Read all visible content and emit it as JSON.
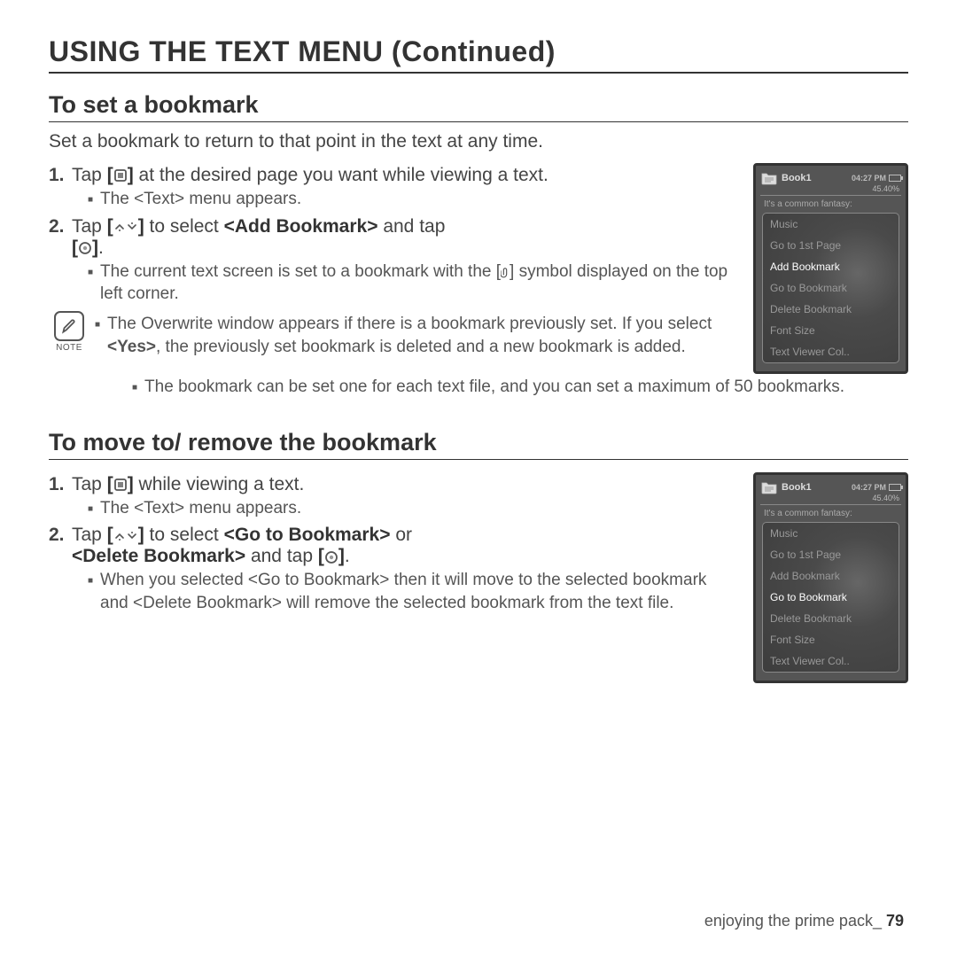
{
  "title": "USING THE TEXT MENU (Continued)",
  "section1": {
    "heading": "To set a bookmark",
    "intro": "Set a bookmark to return to that point in the text at any time.",
    "step1_num": "1.",
    "step1_a": "Tap ",
    "step1_b": " at the desired page you want while viewing a text.",
    "sub1": "The <Text> menu appears.",
    "step2_num": "2.",
    "step2_a": "Tap ",
    "step2_b": " to select ",
    "step2_bold": "<Add Bookmark>",
    "step2_c": " and tap ",
    "step2_d": ".",
    "sub2_a": "The current text screen is set to a bookmark with the ",
    "sub2_b": " symbol displayed on the top left corner.",
    "note_label": "NOTE",
    "note1_a": "The Overwrite window appears if there is a bookmark previously set. If you select ",
    "note1_bold": "<Yes>",
    "note1_b": ", the previously set bookmark is deleted and a new bookmark is added.",
    "note2": "The bookmark can be set one for each text file, and you can set a maximum of 50 bookmarks."
  },
  "section2": {
    "heading": "To move to/ remove the bookmark",
    "step1_num": "1.",
    "step1_a": "Tap ",
    "step1_b": " while viewing a text.",
    "sub1": "The <Text> menu appears.",
    "step2_num": "2.",
    "step2_a": "Tap ",
    "step2_b": " to select ",
    "step2_bold1": "<Go to Bookmark>",
    "step2_c": " or ",
    "step2_bold2": "<Delete Bookmark>",
    "step2_d": " and tap ",
    "step2_e": ".",
    "sub2": "When you selected <Go to Bookmark> then it will move to the selected bookmark and <Delete Bookmark> will remove the selected bookmark from the text file."
  },
  "device1": {
    "book": "Book1",
    "time": "04:27 PM",
    "pct": "45.40%",
    "subtitle": "It's a common fantasy:",
    "items": [
      "Music",
      "Go to 1st Page",
      "Add Bookmark",
      "Go to Bookmark",
      "Delete Bookmark",
      "Font Size",
      "Text Viewer Col.."
    ],
    "selected": 2
  },
  "device2": {
    "book": "Book1",
    "time": "04:27 PM",
    "pct": "45.40%",
    "subtitle": "It's a common fantasy:",
    "items": [
      "Music",
      "Go to 1st Page",
      "Add Bookmark",
      "Go to Bookmark",
      "Delete Bookmark",
      "Font Size",
      "Text Viewer Col.."
    ],
    "selected": 3
  },
  "footer": {
    "text": "enjoying the prime pack_ ",
    "page": "79"
  },
  "icons": {
    "menu_open": "[",
    "menu_close": "]",
    "brackets_open": "[",
    "brackets_close": "]"
  }
}
